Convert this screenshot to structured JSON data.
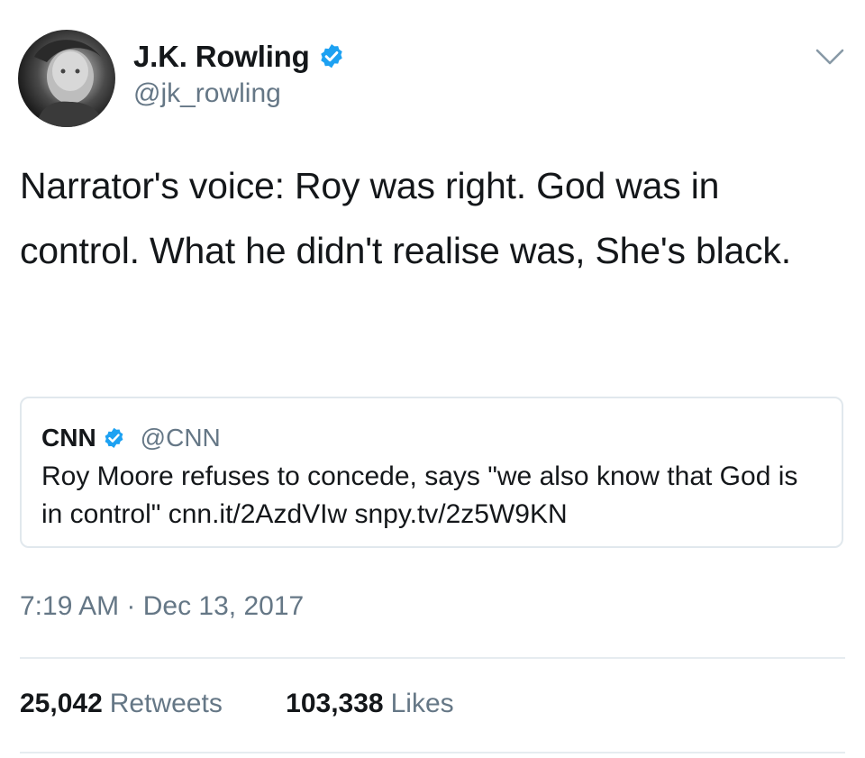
{
  "tweet": {
    "author": {
      "display_name": "J.K. Rowling",
      "handle": "@jk_rowling",
      "verified": true,
      "avatar_icon": "user-avatar"
    },
    "text": "Narrator's voice: Roy was right. God was in control. What he didn't realise was, She's black.",
    "quoted_tweet": {
      "display_name": "CNN",
      "handle": "@CNN",
      "verified": true,
      "text": "Roy Moore refuses to concede, says \"we also know that God is in control\" cnn.it/2AzdVIw snpy.tv/2z5W9KN"
    },
    "timestamp": "7:19 AM · Dec 13, 2017",
    "stats": {
      "retweets_count": "25,042",
      "retweets_label": "Retweets",
      "likes_count": "103,338",
      "likes_label": "Likes"
    },
    "menu_icon": "chevron-down-icon"
  },
  "colors": {
    "verified_blue": "#1da1f2",
    "text_primary": "#14171a",
    "text_secondary": "#657786",
    "border": "#e1e8ed"
  }
}
